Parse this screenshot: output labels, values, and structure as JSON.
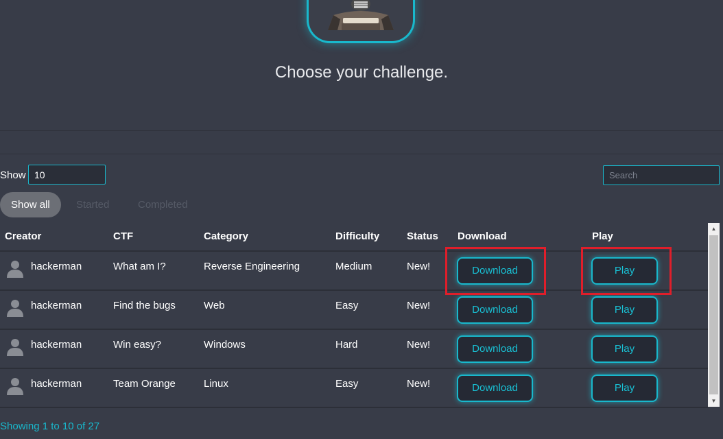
{
  "hero": {
    "title": "Choose your challenge."
  },
  "controls": {
    "show_label": "Show",
    "show_value": "10",
    "search_placeholder": "Search"
  },
  "filters": [
    {
      "label": "Show all",
      "active": true
    },
    {
      "label": "Started",
      "active": false
    },
    {
      "label": "Completed",
      "active": false
    }
  ],
  "table": {
    "columns": [
      "Creator",
      "CTF",
      "Category",
      "Difficulty",
      "Status",
      "Download",
      "Play"
    ],
    "rows": [
      {
        "creator": "hackerman",
        "ctf": "What am I?",
        "category": "Reverse Engineering",
        "difficulty": "Medium",
        "status": "New!",
        "download": "Download",
        "play": "Play"
      },
      {
        "creator": "hackerman",
        "ctf": "Find the bugs",
        "category": "Web",
        "difficulty": "Easy",
        "status": "New!",
        "download": "Download",
        "play": "Play"
      },
      {
        "creator": "hackerman",
        "ctf": "Win easy?",
        "category": "Windows",
        "difficulty": "Hard",
        "status": "New!",
        "download": "Download",
        "play": "Play"
      },
      {
        "creator": "hackerman",
        "ctf": "Team Orange",
        "category": "Linux",
        "difficulty": "Easy",
        "status": "New!",
        "download": "Download",
        "play": "Play"
      }
    ]
  },
  "footer": {
    "info": "Showing 1 to 10 of 27"
  },
  "colors": {
    "background": "#383c48",
    "accent": "#19b8cc",
    "highlight": "#e01e2a"
  },
  "icons": [
    "user-avatar-icon",
    "user-icon",
    "scroll-up-icon",
    "scroll-down-icon"
  ]
}
